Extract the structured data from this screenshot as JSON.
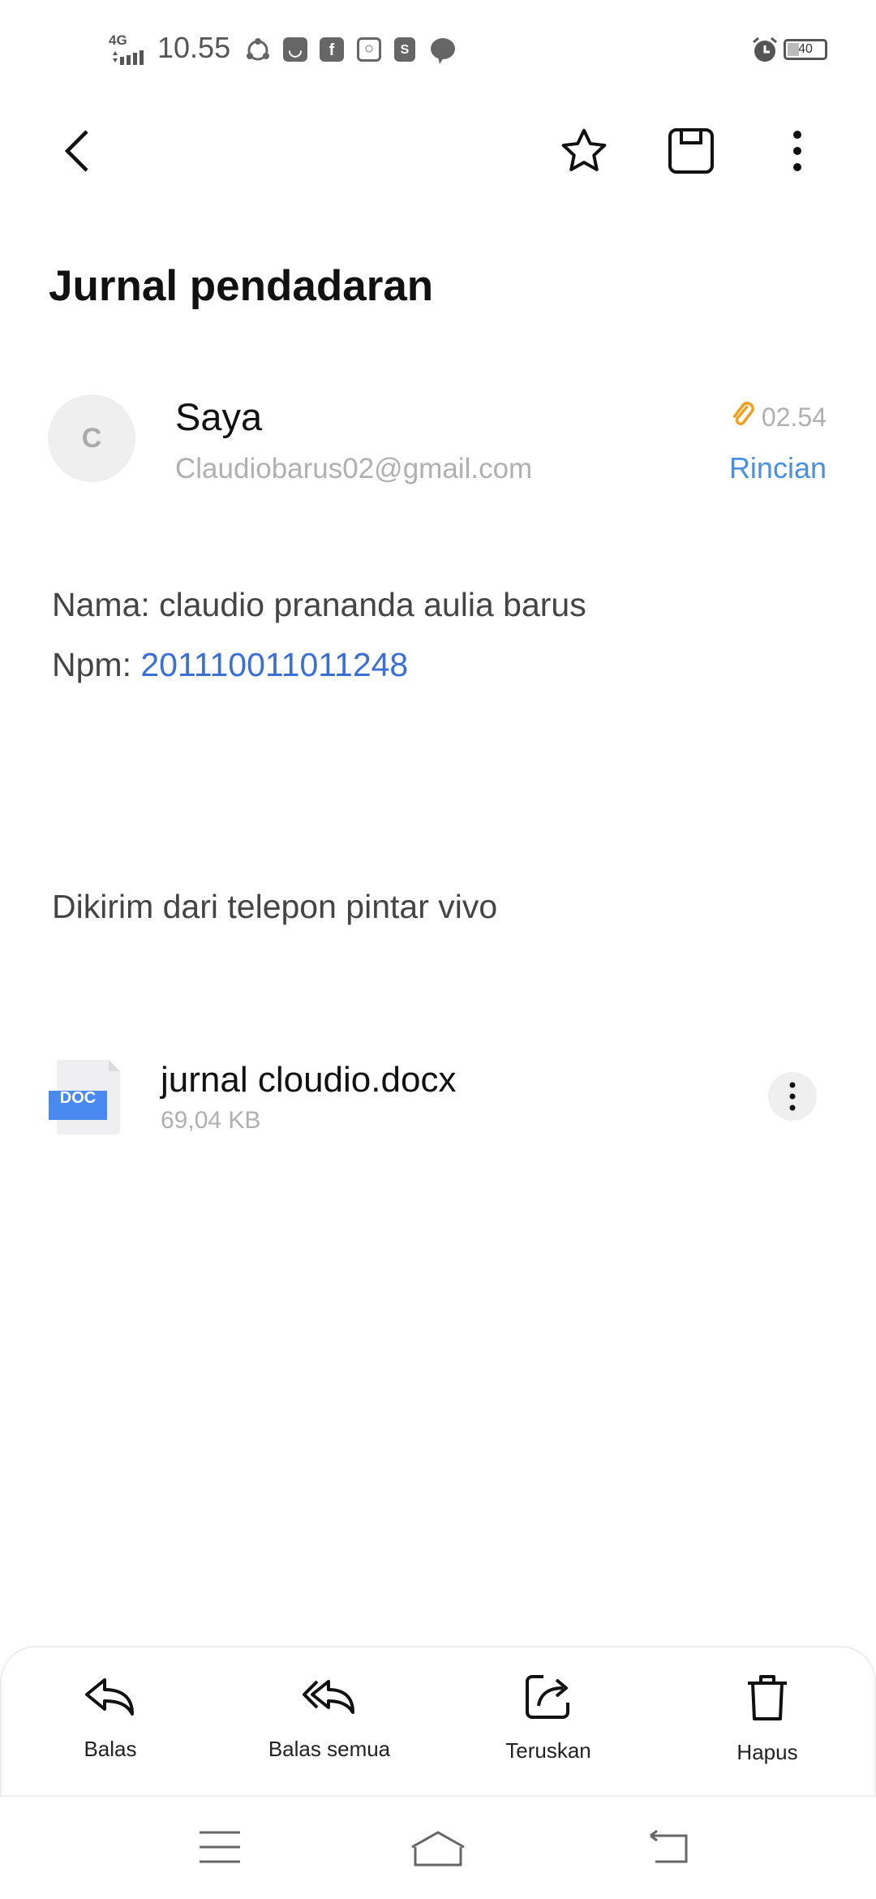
{
  "status_bar": {
    "network": "4G",
    "time": "10.55",
    "battery": "40",
    "notification_icons": [
      "sync-icon",
      "mail-icon",
      "facebook-icon",
      "instagram-icon",
      "shopee-icon",
      "chat-icon"
    ]
  },
  "toolbar": {
    "back": "back-icon",
    "star": "star-icon",
    "save": "save-icon",
    "more": "more-icon"
  },
  "email": {
    "subject": "Jurnal pendadaran",
    "avatar_letter": "C",
    "sender_name": "Saya",
    "sender_email": "Claudiobarus02@gmail.com",
    "time": "02.54",
    "details_label": "Rincian",
    "body": {
      "name_line": "Nama: claudio prananda aulia barus",
      "npm_label": "Npm: ",
      "npm_value": "201110011011248",
      "signature": "Dikirim dari telepon pintar vivo"
    },
    "attachment": {
      "type_label": "DOC",
      "filename": "jurnal cloudio.docx",
      "size": "69,04 KB"
    }
  },
  "actions": [
    {
      "label": "Balas"
    },
    {
      "label": "Balas semua"
    },
    {
      "label": "Teruskan"
    },
    {
      "label": "Hapus"
    }
  ],
  "colors": {
    "accent": "#4a90e2",
    "link": "#3b6fd8",
    "attachment": "#f0a020",
    "doc": "#4a8af0"
  }
}
